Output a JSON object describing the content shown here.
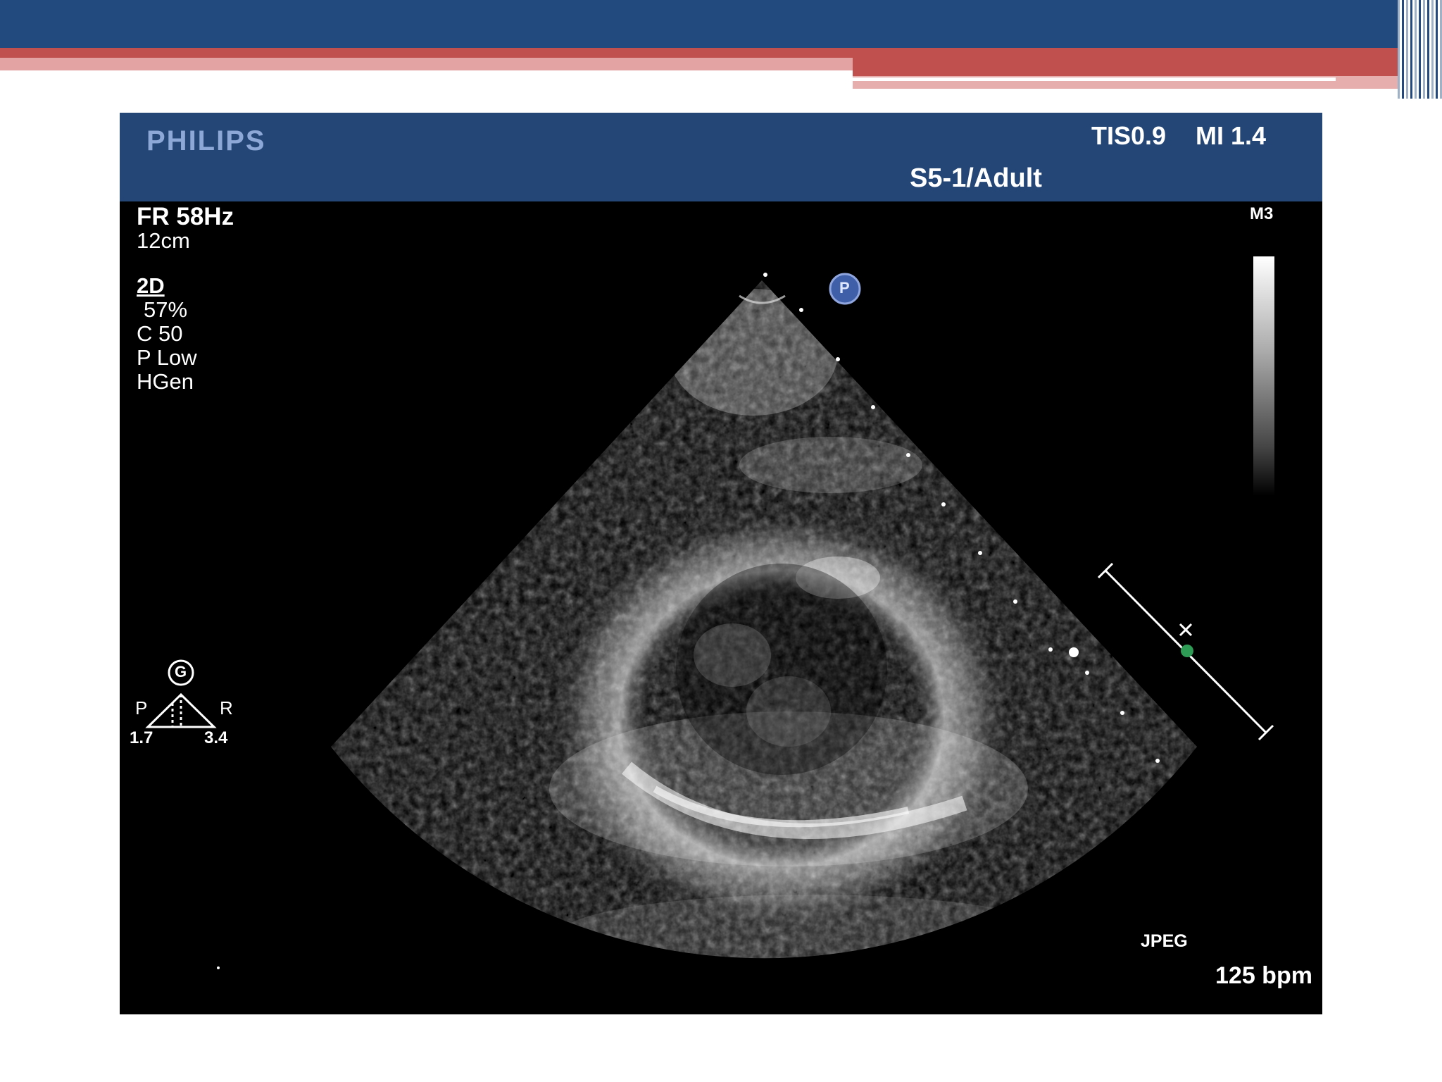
{
  "brand": "PHILIPS",
  "header": {
    "tis": "TIS0.9",
    "mi": "MI 1.4",
    "probe": "S5-1/Adult"
  },
  "params": {
    "frame_rate": "FR 58Hz",
    "depth": "12cm",
    "mode": "2D",
    "gain": "57%",
    "compression": "C 50",
    "power": "P Low",
    "frequency": "HGen"
  },
  "map": "M3",
  "orientation": {
    "marker": "G",
    "left_label": "P",
    "right_label": "R",
    "left_value": "1.7",
    "right_value": "3.4"
  },
  "probe_marker": "P",
  "format": "JPEG",
  "heart_rate": "125 bpm",
  "colors": {
    "header": "#244676",
    "slide_blue": "#234a7e",
    "slide_red": "#c0504d",
    "ecg_dot": "#2e9c55"
  }
}
